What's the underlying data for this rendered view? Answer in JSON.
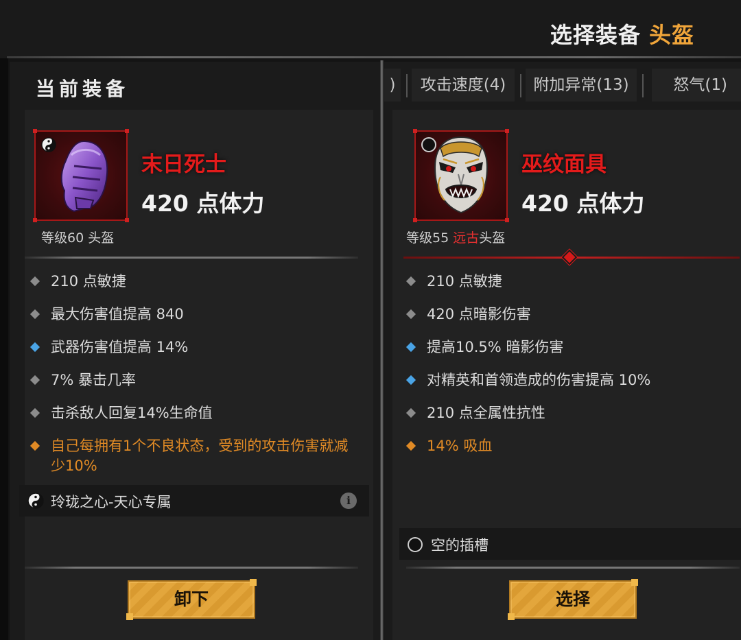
{
  "header": {
    "title_prefix": "选择装备",
    "title_slot": "头盔"
  },
  "current": {
    "panel_title": "当前装备",
    "item_name": "末日死士",
    "main_stat": "420 点体力",
    "level_text": "等级60 头盔",
    "affixes": [
      {
        "text": "210 点敏捷",
        "kind": "normal"
      },
      {
        "text": "最大伤害值提高 840",
        "kind": "normal"
      },
      {
        "text": "武器伤害值提高 14%",
        "kind": "blue"
      },
      {
        "text": "7% 暴击几率",
        "kind": "normal"
      },
      {
        "text": "击杀敌人回复14%生命值",
        "kind": "normal"
      },
      {
        "text": "自己每拥有1个不良状态，受到的攻击伤害就减少10%",
        "kind": "legendary"
      }
    ],
    "aspect_label": "玲珑之心-天心专属",
    "info_icon": "i",
    "action_label": "卸下"
  },
  "candidate": {
    "tabs": [
      ")",
      "攻击速度(4)",
      "附加异常(13)",
      "怒气(1)"
    ],
    "item_name": "巫纹面具",
    "main_stat": "420 点体力",
    "level_prefix": "等级55 ",
    "level_rarity": "远古",
    "level_suffix": "头盔",
    "affixes": [
      {
        "text": "210 点敏捷",
        "kind": "normal"
      },
      {
        "text": "420 点暗影伤害",
        "kind": "normal"
      },
      {
        "text": "提高10.5% 暗影伤害",
        "kind": "blue"
      },
      {
        "text": "对精英和首领造成的伤害提高 10%",
        "kind": "blue"
      },
      {
        "text": "210 点全属性抗性",
        "kind": "normal"
      },
      {
        "text": "14% 吸血",
        "kind": "legendary"
      }
    ],
    "socket_label": "空的插槽",
    "action_label": "选择"
  },
  "icons": {
    "current_item": "purple-helmet-icon",
    "candidate_item": "demon-mask-icon",
    "aspect": "yin-yang-icon",
    "socket": "empty-socket-icon"
  },
  "colors": {
    "accent_gold": "#f0a53a",
    "item_name_red": "#e31b1b",
    "affix_blue": "#4aa4e6",
    "affix_legendary": "#e08a25",
    "button_gold": "#e3a63c"
  }
}
